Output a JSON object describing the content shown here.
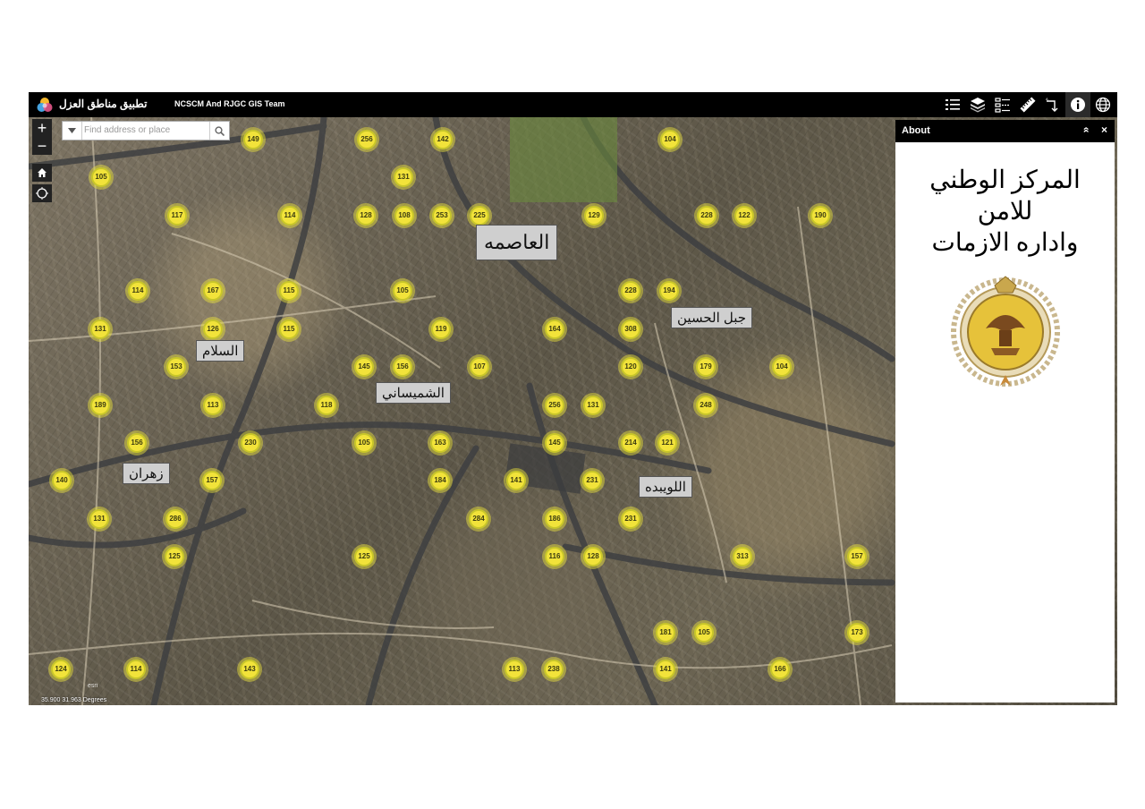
{
  "header": {
    "app_title": "تطبيق مناطق العزل",
    "subtitle": "NCSCM And RJGC GIS Team",
    "tools": [
      "list-icon",
      "layers-icon",
      "legend-icon",
      "measure-icon",
      "directions-icon",
      "info-icon",
      "basemap-gallery-icon"
    ]
  },
  "map": {
    "zoom_in": "+",
    "zoom_out": "−",
    "search_placeholder": "Find address or place",
    "coordinates": "35.900 31.963 Degrees",
    "attribution": "esri",
    "districts": [
      "العاصمه",
      "جبل الحسين",
      "السلام",
      "الشميساني",
      "زهران",
      "اللويبده"
    ],
    "clusters": [
      {
        "label": "149"
      },
      {
        "label": "256"
      },
      {
        "label": "142"
      },
      {
        "label": "104"
      },
      {
        "label": "105"
      },
      {
        "label": "131"
      },
      {
        "label": "117"
      },
      {
        "label": "114"
      },
      {
        "label": "128"
      },
      {
        "label": "108"
      },
      {
        "label": "253"
      },
      {
        "label": "225"
      },
      {
        "label": "129"
      },
      {
        "label": "228"
      },
      {
        "label": "122"
      },
      {
        "label": "190"
      },
      {
        "label": "114"
      },
      {
        "label": "167"
      },
      {
        "label": "115"
      },
      {
        "label": "105"
      },
      {
        "label": "228"
      },
      {
        "label": "194"
      },
      {
        "label": "131"
      },
      {
        "label": "126"
      },
      {
        "label": "115"
      },
      {
        "label": "119"
      },
      {
        "label": "164"
      },
      {
        "label": "308"
      },
      {
        "label": "153"
      },
      {
        "label": "145"
      },
      {
        "label": "156"
      },
      {
        "label": "107"
      },
      {
        "label": "120"
      },
      {
        "label": "179"
      },
      {
        "label": "104"
      },
      {
        "label": "189"
      },
      {
        "label": "113"
      },
      {
        "label": "118"
      },
      {
        "label": "256"
      },
      {
        "label": "131"
      },
      {
        "label": "248"
      },
      {
        "label": "156"
      },
      {
        "label": "230"
      },
      {
        "label": "105"
      },
      {
        "label": "163"
      },
      {
        "label": "145"
      },
      {
        "label": "214"
      },
      {
        "label": "121"
      },
      {
        "label": "140"
      },
      {
        "label": "157"
      },
      {
        "label": "184"
      },
      {
        "label": "141"
      },
      {
        "label": "231"
      },
      {
        "label": "131"
      },
      {
        "label": "286"
      },
      {
        "label": "284"
      },
      {
        "label": "186"
      },
      {
        "label": "231"
      },
      {
        "label": "125"
      },
      {
        "label": "125"
      },
      {
        "label": "116"
      },
      {
        "label": "128"
      },
      {
        "label": "313"
      },
      {
        "label": "157"
      },
      {
        "label": "181"
      },
      {
        "label": "105"
      },
      {
        "label": "173"
      },
      {
        "label": "124"
      },
      {
        "label": "114"
      },
      {
        "label": "143"
      },
      {
        "label": "113"
      },
      {
        "label": "238"
      },
      {
        "label": "141"
      },
      {
        "label": "166"
      }
    ]
  },
  "about_panel": {
    "title": "About",
    "collapse": "»",
    "close": "×",
    "org_line1": "المركز الوطني",
    "org_line2": "للامن",
    "org_line3": "واداره الازمات",
    "emblem": "ncscm-emblem"
  },
  "colors": {
    "topbar": "#000000",
    "cluster_fill": "#f2e33a",
    "district_label_bg": "#cfcfcf"
  }
}
